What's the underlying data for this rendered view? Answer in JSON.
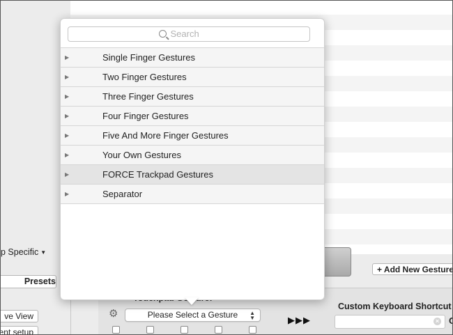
{
  "popover": {
    "search_placeholder": "Search",
    "groups": [
      {
        "label": "Single Finger Gestures"
      },
      {
        "label": "Two Finger Gestures"
      },
      {
        "label": "Three Finger Gestures"
      },
      {
        "label": "Four Finger Gestures"
      },
      {
        "label": "Five And More Finger Gestures"
      },
      {
        "label": "Your Own Gestures"
      },
      {
        "label": "FORCE Trackpad Gestures",
        "highlighted": true
      },
      {
        "label": "Separator"
      }
    ]
  },
  "left_panel": {
    "app_specific_label": "p Specific",
    "presets_label": "Presets",
    "view_label": "ve View",
    "setup_label": "ent setup"
  },
  "toolbar": {
    "add_gesture_label": "+ Add New Gesture"
  },
  "config": {
    "touchpad_label": "Touchpad Gesture:",
    "gesture_select_value": "Please Select a Gesture",
    "arrows": "▶▶▶",
    "shortcut_label": "Custom Keyboard Shortcut",
    "clipped_letter": "C"
  },
  "icons": {
    "disclosure": "disclosure-triangle-icon",
    "search": "search-icon",
    "gear": "gear-icon",
    "clear": "clear-icon"
  }
}
